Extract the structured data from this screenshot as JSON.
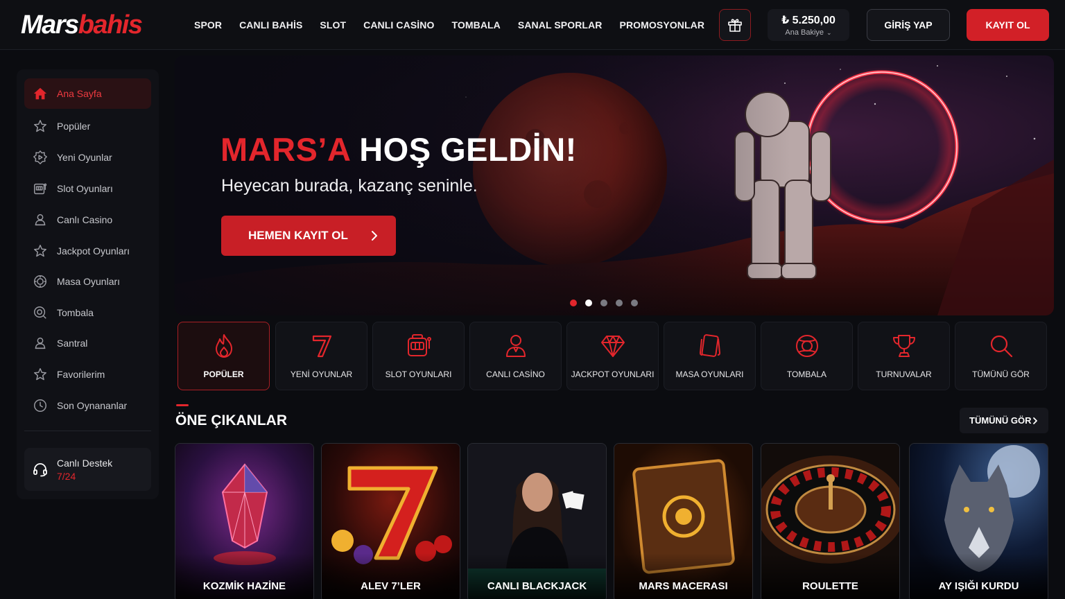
{
  "header": {
    "logo_part1": "Mars",
    "logo_part2": "bahis",
    "nav": [
      "SPOR",
      "CANLI BAHİS",
      "SLOT",
      "CANLI CASİNO",
      "TOMBALA",
      "SANAL SPORLAR",
      "PROMOSYONLAR"
    ],
    "balance_amount": "₺ 5.250,00",
    "balance_label": "Ana Bakiye",
    "login_label": "GİRİŞ YAP",
    "register_label": "KAYIT OL",
    "icons": {
      "gift": "gift-icon",
      "balance_dropdown": "chevron-down-icon"
    }
  },
  "sidebar": {
    "items": [
      {
        "label": "Ana Sayfa",
        "icon": "home-icon",
        "active": true
      },
      {
        "label": "Popüler",
        "icon": "star-icon"
      },
      {
        "label": "Yeni Oyunlar",
        "icon": "badge-icon"
      },
      {
        "label": "Slot Oyunları",
        "icon": "slot-machine-icon"
      },
      {
        "label": "Canlı Casino",
        "icon": "dealer-icon"
      },
      {
        "label": "Jackpot Oyunları",
        "icon": "star-outline-icon"
      },
      {
        "label": "Masa Oyunları",
        "icon": "chip-icon"
      },
      {
        "label": "Tombala",
        "icon": "bingo-ball-icon"
      },
      {
        "label": "Santral",
        "icon": "dealer-icon"
      },
      {
        "label": "Favorilerim",
        "icon": "star-icon"
      },
      {
        "label": "Son Oynananlar",
        "icon": "clock-icon"
      }
    ],
    "support_title": "Canlı Destek",
    "support_hours": "7/24"
  },
  "hero": {
    "title_red": "MARS’A",
    "title_white": "HOŞ GELDİN!",
    "subtitle": "Heyecan burada, kazanç seninle.",
    "cta_label": "HEMEN KAYIT OL",
    "slide_count": 5,
    "active_slide": 2
  },
  "categories": [
    {
      "label": "POPÜLER",
      "icon": "fire-icon",
      "active": true
    },
    {
      "label": "YENİ OYUNLAR",
      "icon": "seven-icon"
    },
    {
      "label": "SLOT OYUNLARI",
      "icon": "slot-machine-icon"
    },
    {
      "label": "CANLI CASİNO",
      "icon": "dealer-icon"
    },
    {
      "label": "JACKPOT OYUNLARI",
      "icon": "diamond-icon"
    },
    {
      "label": "MASA OYUNLARI",
      "icon": "cards-icon"
    },
    {
      "label": "TOMBALA",
      "icon": "bingo-ball-icon"
    },
    {
      "label": "TURNUVALAR",
      "icon": "trophy-icon"
    },
    {
      "label": "TÜMÜNÜ GÖR",
      "icon": "search-icon"
    }
  ],
  "featured": {
    "title": "ÖNE ÇIKANLAR",
    "see_all_label": "TÜMÜNÜ GÖR",
    "games": [
      {
        "title": "KOZMİK HAZİNE"
      },
      {
        "title": "ALEV 7’LER"
      },
      {
        "title": "CANLI BLACKJACK"
      },
      {
        "title": "MARS MACERASI"
      },
      {
        "title": "ROULETTE"
      },
      {
        "title": "AY IŞIĞI KURDU"
      }
    ]
  },
  "colors": {
    "accent": "#e3262c",
    "background": "#0b0c10",
    "panel": "#111217"
  }
}
